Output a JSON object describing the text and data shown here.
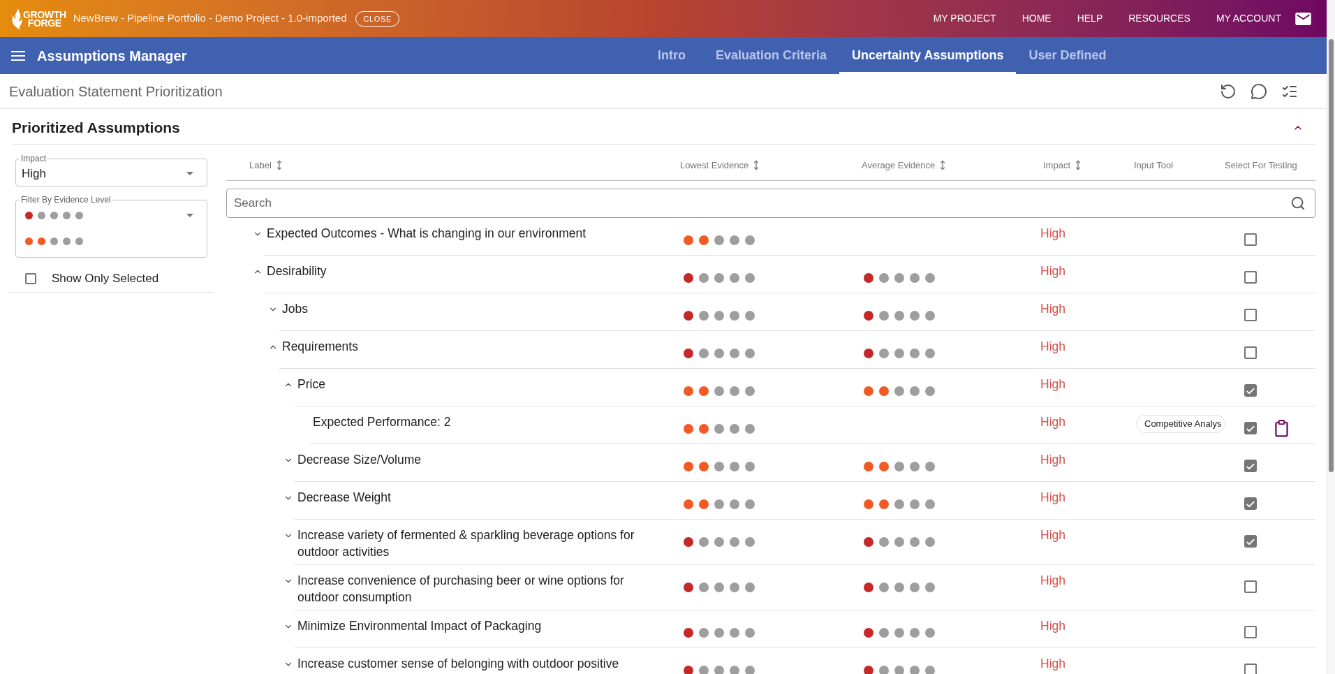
{
  "top_bar": {
    "logo": {
      "lines": [
        "GROWTH",
        "FORGE"
      ]
    },
    "project_title": "NewBrew - Pipeline Portfolio - Demo Project - 1.0-imported",
    "close_button": "CLOSE",
    "nav_links": [
      "MY PROJECT",
      "HOME",
      "HELP",
      "RESOURCES",
      "MY ACCOUNT"
    ]
  },
  "app_bar": {
    "title": "Assumptions Manager",
    "tabs": [
      {
        "label": "Intro",
        "selected": false
      },
      {
        "label": "Evaluation Criteria",
        "selected": false
      },
      {
        "label": "Uncertainty Assumptions",
        "selected": true
      },
      {
        "label": "User Defined",
        "selected": false
      }
    ]
  },
  "toolbar": {
    "title": "Evaluation Statement Prioritization"
  },
  "section": {
    "title": "Prioritized Assumptions",
    "expanded": true
  },
  "filters": {
    "impact": {
      "label": "Impact",
      "value": "High"
    },
    "evidence": {
      "label": "Filter By Evidence Level",
      "values": [
        {
          "stars": 1
        },
        {
          "stars": 2
        }
      ]
    },
    "show_only_selected": {
      "label": "Show Only Selected",
      "checked": false
    }
  },
  "table": {
    "columns": [
      {
        "label": "Label",
        "sortable": true
      },
      {
        "label": "Lowest Evidence",
        "sortable": true
      },
      {
        "label": "Average Evidence",
        "sortable": true
      },
      {
        "label": "Impact",
        "sortable": true
      },
      {
        "label": "Input Tool",
        "sortable": false
      },
      {
        "label": "Select For Testing",
        "sortable": false
      }
    ],
    "search": {
      "placeholder": "Search"
    },
    "rows": [
      {
        "label": "Expected Outcomes - What is changing in our environment",
        "expanded": false,
        "lowest_evidence": {
          "stars": 2
        },
        "impact": "High",
        "checked": false
      },
      {
        "label": "Desirability",
        "expanded": true,
        "lowest_evidence": {
          "stars": 1
        },
        "average_evidence": {
          "stars": 1
        },
        "impact": "High",
        "checked": false,
        "children": [
          {
            "label": "Jobs",
            "expanded": false,
            "lowest_evidence": {
              "stars": 1
            },
            "average_evidence": {
              "stars": 1
            },
            "impact": "High",
            "checked": false
          },
          {
            "label": "Requirements",
            "expanded": true,
            "lowest_evidence": {
              "stars": 1
            },
            "average_evidence": {
              "stars": 1
            },
            "impact": "High",
            "checked": false,
            "children": [
              {
                "label": "Price",
                "expanded": true,
                "lowest_evidence": {
                  "stars": 2
                },
                "average_evidence": {
                  "stars": 2
                },
                "impact": "High",
                "checked": true,
                "children": [
                  {
                    "label": "Expected Performance: 2",
                    "lowest_evidence": {
                      "stars": 2
                    },
                    "impact": "High",
                    "input_tool": "Competitive Analys",
                    "checked": true
                  }
                ]
              },
              {
                "label": "Decrease Size/Volume",
                "expanded": false,
                "lowest_evidence": {
                  "stars": 2
                },
                "average_evidence": {
                  "stars": 2
                },
                "impact": "High",
                "checked": true
              },
              {
                "label": "Decrease Weight",
                "expanded": false,
                "lowest_evidence": {
                  "stars": 2
                },
                "average_evidence": {
                  "stars": 2
                },
                "impact": "High",
                "checked": true
              },
              {
                "label": "Increase variety of fermented & sparkling beverage options for outdoor activities",
                "expanded": false,
                "lowest_evidence": {
                  "stars": 1
                },
                "average_evidence": {
                  "stars": 1
                },
                "impact": "High",
                "checked": true
              },
              {
                "label": "Increase convenience of purchasing beer or wine options for outdoor consumption",
                "expanded": false,
                "lowest_evidence": {
                  "stars": 1
                },
                "average_evidence": {
                  "stars": 1
                },
                "impact": "High",
                "checked": false
              },
              {
                "label": "Minimize Environmental Impact of Packaging",
                "expanded": false,
                "lowest_evidence": {
                  "stars": 1
                },
                "average_evidence": {
                  "stars": 1
                },
                "impact": "High",
                "checked": false
              },
              {
                "label": "Increase customer sense of belonging with outdoor positive",
                "expanded": false,
                "lowest_evidence": {
                  "stars": 1
                },
                "average_evidence": {
                  "stars": 1
                },
                "impact": "High",
                "checked": false
              }
            ]
          }
        ]
      }
    ]
  }
}
